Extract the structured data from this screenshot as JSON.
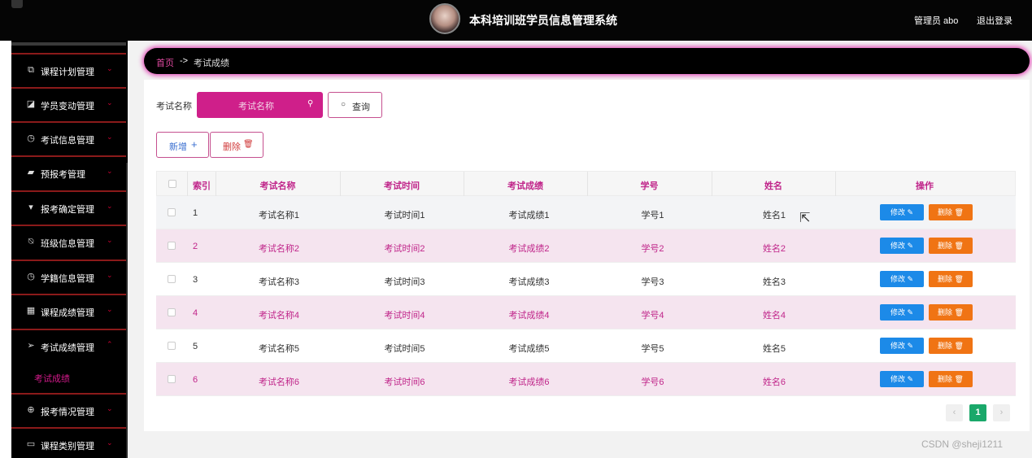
{
  "header": {
    "title": "本科培训班学员信息管理系统",
    "user": "管理员 abo",
    "logout": "退出登录"
  },
  "sidebar": {
    "items": [
      {
        "label": "课程计划管理",
        "icon": "copy-icon"
      },
      {
        "label": "学员变动管理",
        "icon": "edit-icon"
      },
      {
        "label": "考试信息管理",
        "icon": "compass-icon"
      },
      {
        "label": "预报考管理",
        "icon": "thumb-icon"
      },
      {
        "label": "报考确定管理",
        "icon": "pin-icon"
      },
      {
        "label": "班级信息管理",
        "icon": "bell-off-icon"
      },
      {
        "label": "学籍信息管理",
        "icon": "compass-icon"
      },
      {
        "label": "课程成绩管理",
        "icon": "grid-icon"
      },
      {
        "label": "考试成绩管理",
        "icon": "send-icon"
      },
      {
        "label": "报考情况管理",
        "icon": "globe-icon"
      },
      {
        "label": "课程类别管理",
        "icon": "monitor-icon"
      }
    ],
    "active_submenu": "考试成绩"
  },
  "breadcrumb": {
    "home": "首页",
    "arrow": "->",
    "current": "考试成绩"
  },
  "search": {
    "label": "考试名称",
    "placeholder": "考试名称",
    "query_label": "查询"
  },
  "toolbar": {
    "add_label": "新增",
    "delete_label": "删除"
  },
  "table": {
    "headers": [
      "索引",
      "考试名称",
      "考试时间",
      "考试成绩",
      "学号",
      "姓名",
      "操作"
    ],
    "rows": [
      {
        "idx": "1",
        "name": "考试名称1",
        "time": "考试时间1",
        "score": "考试成绩1",
        "sid": "学号1",
        "sname": "姓名1"
      },
      {
        "idx": "2",
        "name": "考试名称2",
        "time": "考试时间2",
        "score": "考试成绩2",
        "sid": "学号2",
        "sname": "姓名2"
      },
      {
        "idx": "3",
        "name": "考试名称3",
        "time": "考试时间3",
        "score": "考试成绩3",
        "sid": "学号3",
        "sname": "姓名3"
      },
      {
        "idx": "4",
        "name": "考试名称4",
        "time": "考试时间4",
        "score": "考试成绩4",
        "sid": "学号4",
        "sname": "姓名4"
      },
      {
        "idx": "5",
        "name": "考试名称5",
        "time": "考试时间5",
        "score": "考试成绩5",
        "sid": "学号5",
        "sname": "姓名5"
      },
      {
        "idx": "6",
        "name": "考试名称6",
        "time": "考试时间6",
        "score": "考试成绩6",
        "sid": "学号6",
        "sname": "姓名6"
      }
    ],
    "edit_label": "修改",
    "delete_label": "删除"
  },
  "pagination": {
    "current": "1",
    "prev": "‹",
    "next": "›"
  },
  "watermark": "CSDN @sheji1211",
  "colors": {
    "accent": "#cf1f8a",
    "edit": "#1c8ae8",
    "delete": "#f07414",
    "page": "#1aa86a"
  }
}
